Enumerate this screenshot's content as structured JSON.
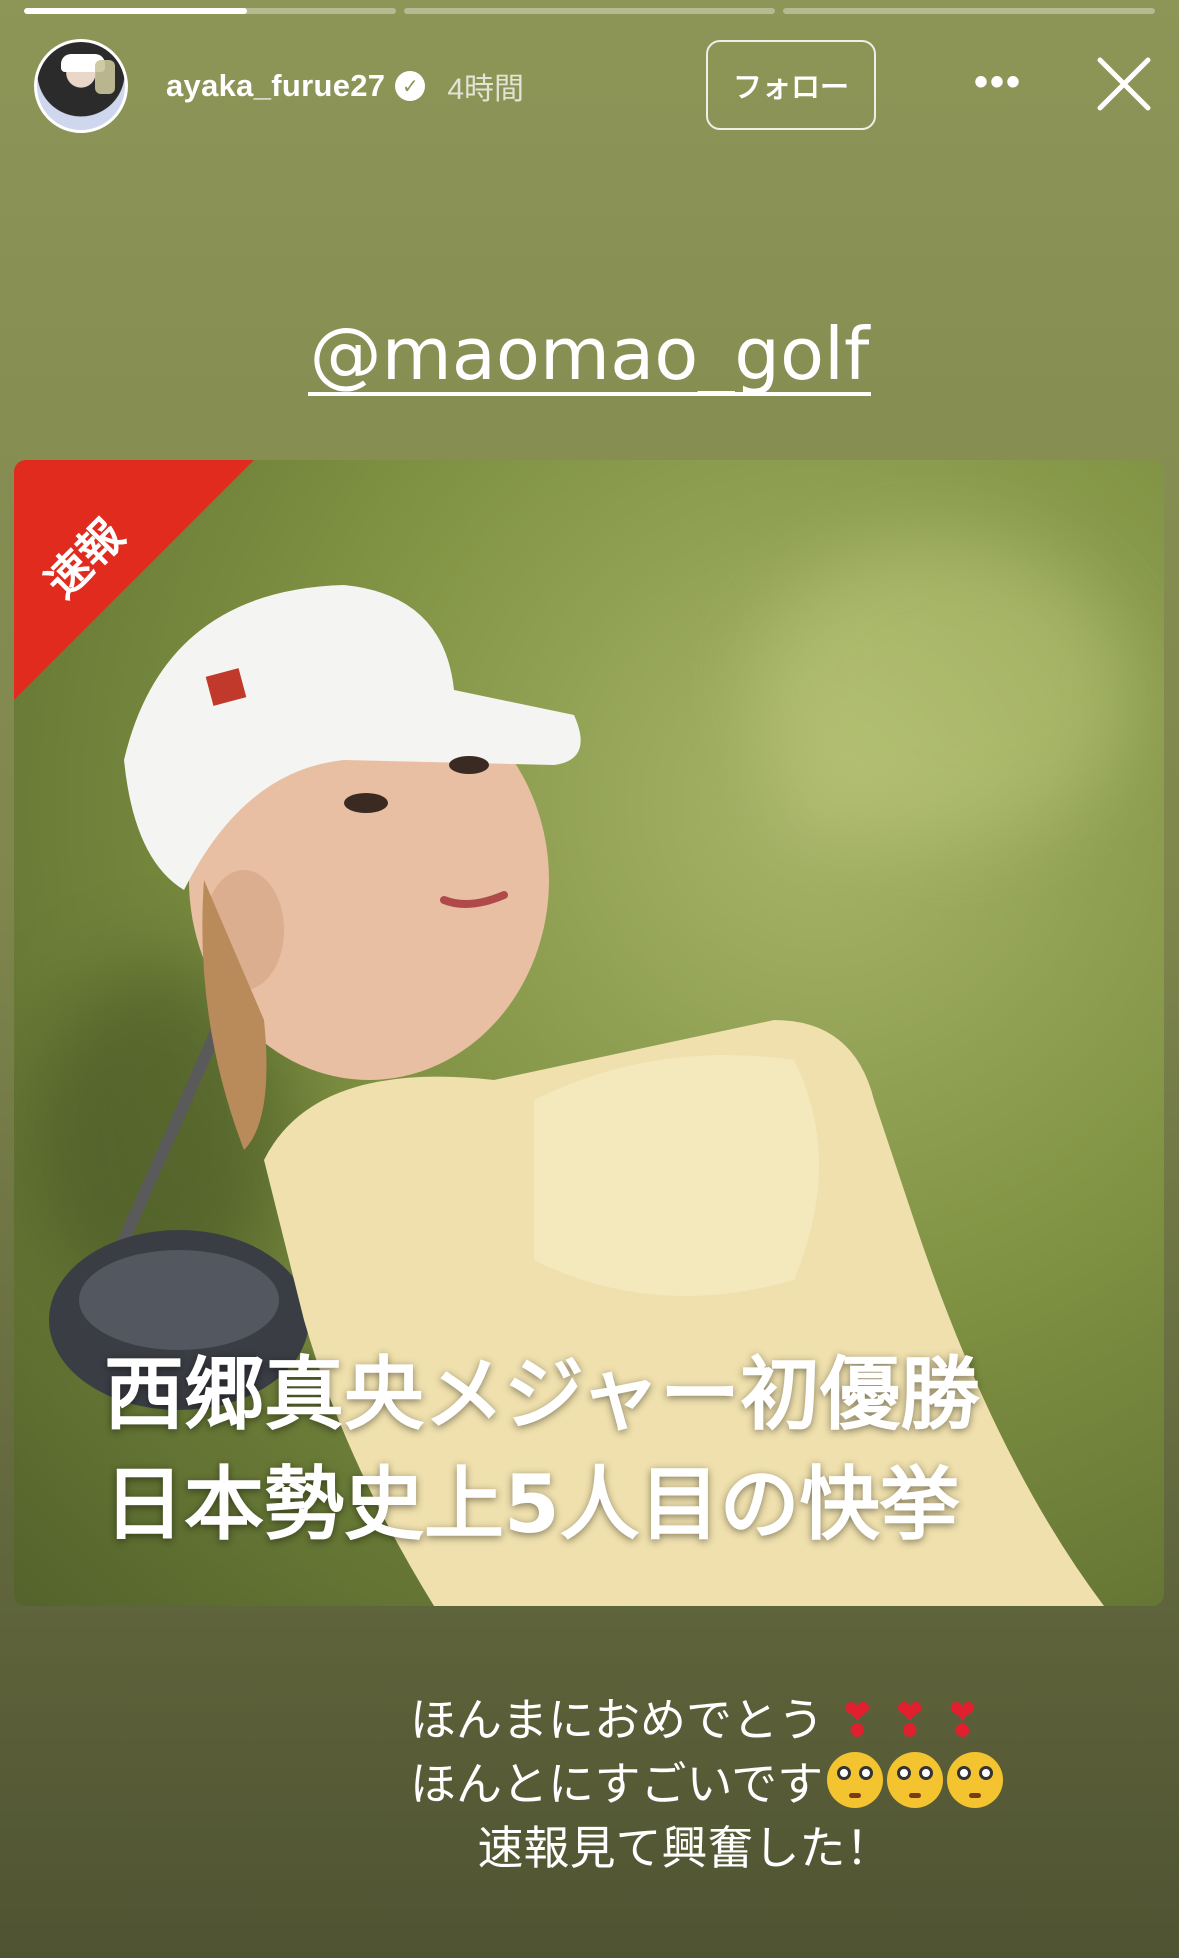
{
  "story": {
    "progress": [
      0.6,
      0,
      0
    ],
    "username": "ayaka_furue27",
    "time": "4時間",
    "follow_label": "フォロー",
    "more_label": "•••",
    "mention": "@maomao_golf"
  },
  "card": {
    "ribbon": "速報",
    "headline_line1": "西郷真央メジャー初優勝",
    "headline_line2": "日本勢史上5人目の快挙"
  },
  "caption": {
    "line1": "ほんまにおめでとう",
    "line2": "ほんとにすごいです",
    "line3": "速報見て興奮した！",
    "heart": "❣"
  },
  "colors": {
    "background": "#878f53",
    "ribbon": "#e02b1e",
    "heart": "#e0202e"
  }
}
